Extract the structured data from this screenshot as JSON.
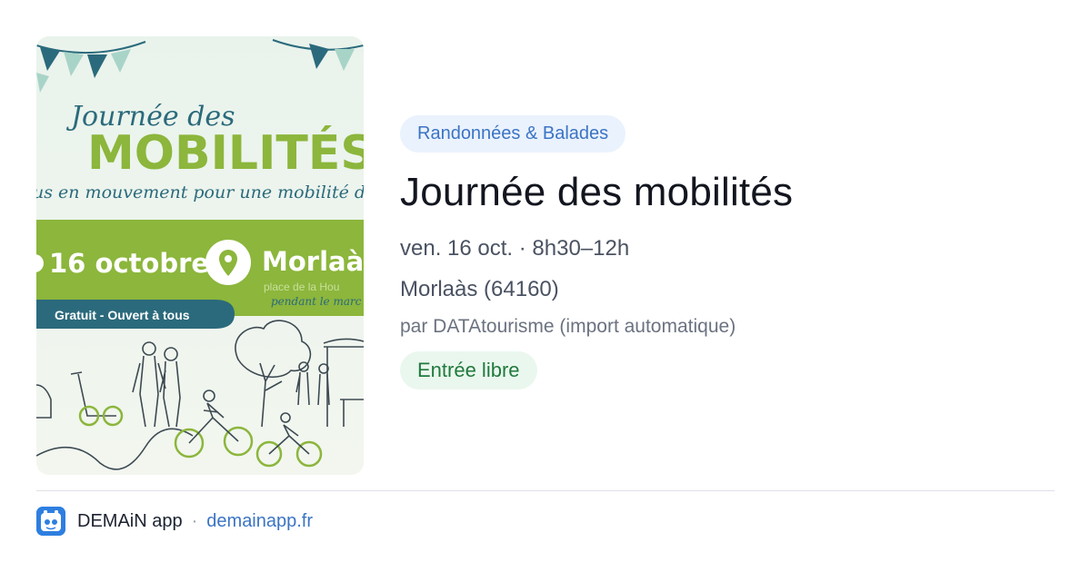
{
  "poster": {
    "title_script": "Journée des",
    "title_big": "MOBILITÉS",
    "tagline": "us en mouvement pour une mobilité dura",
    "date": "16 octobre",
    "city": "Morlaàs",
    "place": "place de la Hou",
    "subnote": "pendant le marc",
    "ribbon": "Gratuit - Ouvert à tous"
  },
  "event": {
    "category": "Randonnées & Balades",
    "title": "Journée des mobilités",
    "date_time": "ven. 16 oct. · 8h30–12h",
    "location": "Morlaàs (64160)",
    "organizer": "par DATAtourisme (import automatique)",
    "price": "Entrée libre"
  },
  "footer": {
    "app_name": "DEMAiN app",
    "separator": "·",
    "domain": "demainapp.fr"
  },
  "colors": {
    "poster_green": "#8cb63c",
    "poster_teal": "#2b6a7c",
    "category_text": "#3b74c4",
    "price_text": "#217a3d",
    "link": "#3b74c4"
  },
  "icons": [
    "location-pin-icon",
    "app-logo-icon"
  ]
}
